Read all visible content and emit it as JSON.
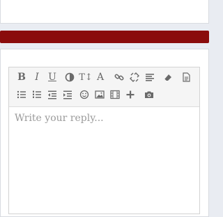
{
  "editor": {
    "placeholder": "Write your reply...",
    "toolbar_text": {
      "bold": "B",
      "italic": "I",
      "underline": "U",
      "font_size": "T↕",
      "font": "A"
    }
  },
  "colors": {
    "accent_bar": "#8a0c0c",
    "toolbar_icon": "#6a6a6a",
    "placeholder": "#9a9a9a"
  }
}
